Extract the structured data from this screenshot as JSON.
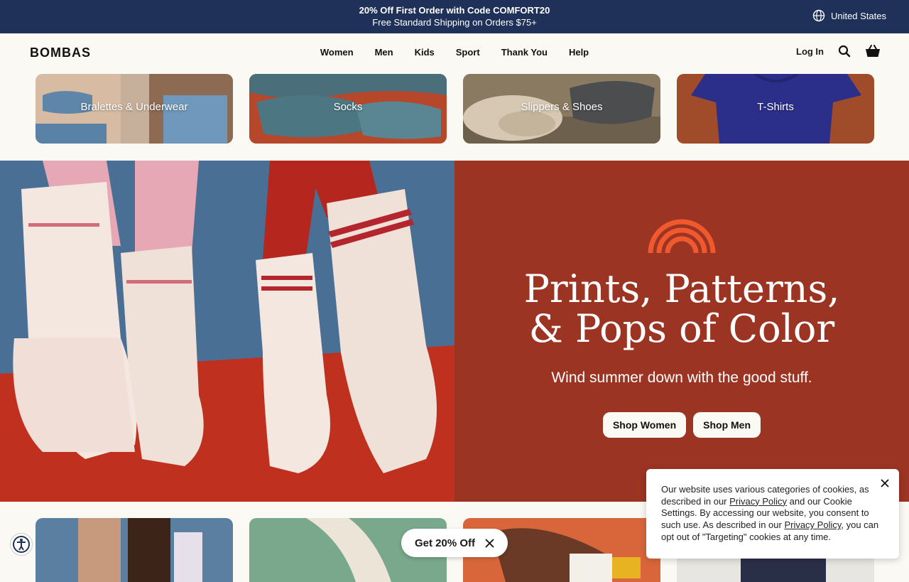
{
  "announcement": {
    "line1": "20% Off First Order with Code COMFORT20",
    "line2": "Free Standard Shipping on Orders $75+",
    "region": "United States"
  },
  "header": {
    "logo": "BOMBAS",
    "nav": [
      "Women",
      "Men",
      "Kids",
      "Sport",
      "Thank You",
      "Help"
    ],
    "login": "Log In"
  },
  "categories": [
    "Bralettes & Underwear",
    "Socks",
    "Slippers & Shoes",
    "T-Shirts"
  ],
  "hero": {
    "title_line1": "Prints, Patterns,",
    "title_line2": "& Pops of Color",
    "subtitle": "Wind summer down with the good stuff.",
    "btn_women": "Shop Women",
    "btn_men": "Shop Men"
  },
  "promo": {
    "label": "Get 20% Off"
  },
  "cookie": {
    "t1": "Our website uses various categories of cookies, as described in our ",
    "link1": "Privacy Policy",
    "t2": " and our Cookie Settings. By accessing our website, you consent to such use. As described in our ",
    "link2": "Privacy Policy",
    "t3": ", you can opt out of \"Targeting\" cookies at any time."
  },
  "colors": {
    "announce_bg": "#1f3158",
    "hero_panel": "#9c3423",
    "rainbow": "#f0582e"
  }
}
